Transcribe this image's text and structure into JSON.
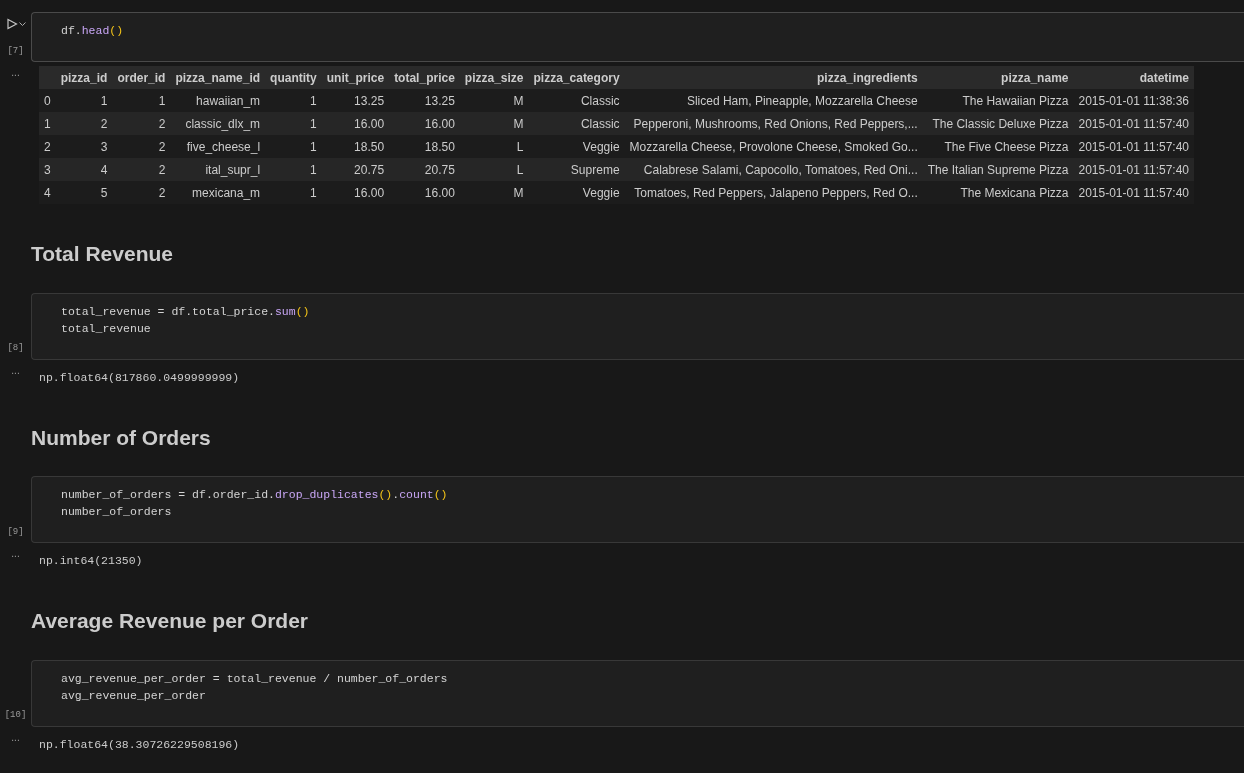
{
  "cells": [
    {
      "kind": "code",
      "run_button": true,
      "execution_count": "[7]",
      "lines": [
        [
          {
            "t": "df.",
            "kind": "text"
          },
          {
            "t": "head",
            "kind": "method"
          },
          {
            "t": "()",
            "kind": "bracket"
          }
        ]
      ],
      "output_marker": "...",
      "output": {
        "kind": "table",
        "columns": [
          "",
          "pizza_id",
          "order_id",
          "pizza_name_id",
          "quantity",
          "unit_price",
          "total_price",
          "pizza_size",
          "pizza_category",
          "pizza_ingredients",
          "pizza_name",
          "datetime"
        ],
        "rows": [
          [
            "0",
            "1",
            "1",
            "hawaiian_m",
            "1",
            "13.25",
            "13.25",
            "M",
            "Classic",
            "Sliced Ham, Pineapple, Mozzarella Cheese",
            "The Hawaiian Pizza",
            "2015-01-01 11:38:36"
          ],
          [
            "1",
            "2",
            "2",
            "classic_dlx_m",
            "1",
            "16.00",
            "16.00",
            "M",
            "Classic",
            "Pepperoni, Mushrooms, Red Onions, Red Peppers,...",
            "The Classic Deluxe Pizza",
            "2015-01-01 11:57:40"
          ],
          [
            "2",
            "3",
            "2",
            "five_cheese_l",
            "1",
            "18.50",
            "18.50",
            "L",
            "Veggie",
            "Mozzarella Cheese, Provolone Cheese, Smoked Go...",
            "The Five Cheese Pizza",
            "2015-01-01 11:57:40"
          ],
          [
            "3",
            "4",
            "2",
            "ital_supr_l",
            "1",
            "20.75",
            "20.75",
            "L",
            "Supreme",
            "Calabrese Salami, Capocollo, Tomatoes, Red Oni...",
            "The Italian Supreme Pizza",
            "2015-01-01 11:57:40"
          ],
          [
            "4",
            "5",
            "2",
            "mexicana_m",
            "1",
            "16.00",
            "16.00",
            "M",
            "Veggie",
            "Tomatoes, Red Peppers, Jalapeno Peppers, Red O...",
            "The Mexicana Pizza",
            "2015-01-01 11:57:40"
          ]
        ]
      }
    },
    {
      "kind": "heading",
      "text": "Total Revenue"
    },
    {
      "kind": "code",
      "run_button": false,
      "execution_count": "[8]",
      "lines": [
        [
          {
            "t": "total_revenue = df.total_price.",
            "kind": "text"
          },
          {
            "t": "sum",
            "kind": "method"
          },
          {
            "t": "()",
            "kind": "bracket"
          }
        ],
        [
          {
            "t": "total_revenue",
            "kind": "text"
          }
        ]
      ],
      "output_marker": "...",
      "output": {
        "kind": "text",
        "text": "np.float64(817860.0499999999)"
      }
    },
    {
      "kind": "heading",
      "text": "Number of Orders"
    },
    {
      "kind": "code",
      "run_button": false,
      "execution_count": "[9]",
      "lines": [
        [
          {
            "t": "number_of_orders = df.order_id.",
            "kind": "text"
          },
          {
            "t": "drop_duplicates",
            "kind": "method"
          },
          {
            "t": "()",
            "kind": "bracket"
          },
          {
            "t": ".",
            "kind": "text"
          },
          {
            "t": "count",
            "kind": "method"
          },
          {
            "t": "()",
            "kind": "bracket"
          }
        ],
        [
          {
            "t": "number_of_orders",
            "kind": "text"
          }
        ]
      ],
      "output_marker": "...",
      "output": {
        "kind": "text",
        "text": "np.int64(21350)"
      }
    },
    {
      "kind": "heading",
      "text": "Average Revenue per Order"
    },
    {
      "kind": "code",
      "run_button": false,
      "execution_count": "[10]",
      "lines": [
        [
          {
            "t": "avg_revenue_per_order = total_revenue / number_of_orders",
            "kind": "text"
          }
        ],
        [
          {
            "t": "avg_revenue_per_order",
            "kind": "text"
          }
        ]
      ],
      "output_marker": "...",
      "output": {
        "kind": "text",
        "text": "np.float64(38.30726229508196)"
      }
    }
  ]
}
